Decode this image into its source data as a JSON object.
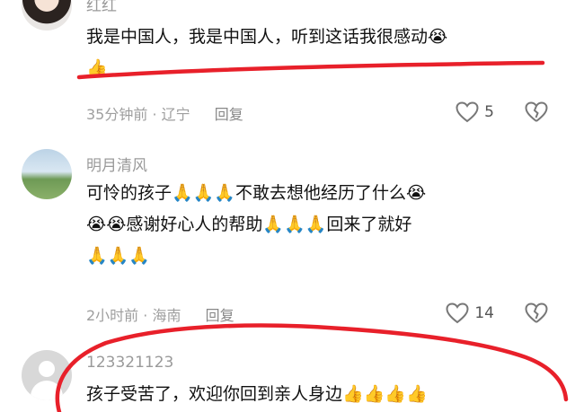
{
  "comments": [
    {
      "username": "红红",
      "text": "我是中国人，我是中国人，听到这话我很感动",
      "emoji_inline": "😭",
      "emoji_line2": "👍",
      "time": "35分钟前",
      "location": "辽宁",
      "reply_label": "回复",
      "likes": "5"
    },
    {
      "username": "明月清风",
      "line1": "可怜的孩子🙏🙏🙏不敢去想他经历了什么😭",
      "line2": "😭😭感谢好心人的帮助🙏🙏🙏回来了就好",
      "line3": "🙏🙏🙏",
      "time": "2小时前",
      "location": "海南",
      "reply_label": "回复",
      "likes": "14"
    },
    {
      "username": "123321123",
      "text": "孩子受苦了，欢迎你回到亲人身边👍👍👍👍"
    }
  ],
  "separator": "·",
  "colors": {
    "annotation_red": "#e8202a",
    "meta_gray": "#9e9e9e"
  },
  "icons": [
    "heart-outline-icon",
    "broken-heart-icon"
  ]
}
